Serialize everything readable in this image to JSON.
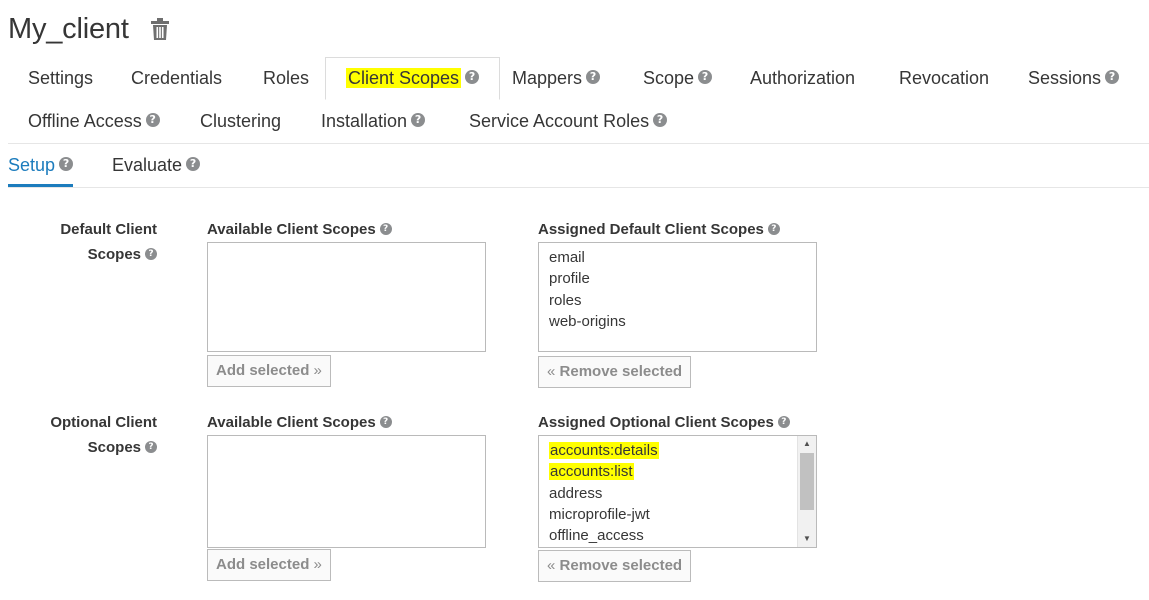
{
  "page": {
    "title": "My_client"
  },
  "tabs": [
    {
      "label": "Settings",
      "help": false
    },
    {
      "label": "Credentials",
      "help": false
    },
    {
      "label": "Roles",
      "help": false
    },
    {
      "label": "Client Scopes",
      "help": true,
      "active": true,
      "highlighted": true
    },
    {
      "label": "Mappers",
      "help": true
    },
    {
      "label": "Scope",
      "help": true
    },
    {
      "label": "Authorization",
      "help": false
    },
    {
      "label": "Revocation",
      "help": false
    },
    {
      "label": "Sessions",
      "help": true
    },
    {
      "label": "Offline Access",
      "help": true
    },
    {
      "label": "Clustering",
      "help": false
    },
    {
      "label": "Installation",
      "help": true
    },
    {
      "label": "Service Account Roles",
      "help": true
    }
  ],
  "subtabs": [
    {
      "label": "Setup",
      "active": true
    },
    {
      "label": "Evaluate",
      "active": false
    }
  ],
  "default_scopes": {
    "label_line1": "Default Client",
    "label_line2": "Scopes",
    "available_label": "Available Client Scopes",
    "assigned_label": "Assigned Default Client Scopes",
    "available": [],
    "assigned": [
      "email",
      "profile",
      "roles",
      "web-origins"
    ],
    "add_button": "Add selected",
    "remove_button": "Remove selected"
  },
  "optional_scopes": {
    "label_line1": "Optional Client",
    "label_line2": "Scopes",
    "available_label": "Available Client Scopes",
    "assigned_label": "Assigned Optional Client Scopes",
    "available": [],
    "assigned": [
      "accounts:details",
      "accounts:list",
      "address",
      "microprofile-jwt",
      "offline_access"
    ],
    "highlighted": [
      "accounts:details",
      "accounts:list"
    ],
    "add_button": "Add selected",
    "remove_button": "Remove selected"
  },
  "icons": {
    "help": "question-circle-icon",
    "trash": "trash-icon",
    "add_chevron": "»",
    "remove_chevron": "«"
  },
  "colors": {
    "accent": "#1c7cbd",
    "highlight": "#ffff00",
    "text": "#363636",
    "help_icon": "#8b8d8f"
  }
}
